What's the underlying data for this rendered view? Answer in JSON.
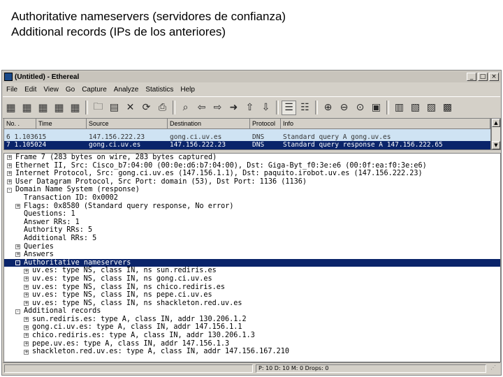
{
  "caption": {
    "line1": "Authoritative nameservers (servidores de confianza)",
    "line2": "Additional records (IPs de los anteriores)"
  },
  "window": {
    "title": "(Untitled) - Ethereal",
    "minimize": "_",
    "maximize": "□",
    "close": "×"
  },
  "menu": [
    "File",
    "Edit",
    "View",
    "Go",
    "Capture",
    "Analyze",
    "Statistics",
    "Help"
  ],
  "toolbar_icons": [
    "interfaces-icon",
    "capture-options-icon",
    "capture-start-icon",
    "capture-stop-icon",
    "capture-restart-icon",
    "open-file-icon",
    "save-file-icon",
    "close-file-icon",
    "reload-icon",
    "print-icon",
    "find-packet-icon",
    "go-back-icon",
    "go-forward-icon",
    "go-to-packet-icon",
    "go-first-icon",
    "go-last-icon",
    "colorize-icon",
    "auto-scroll-icon",
    "zoom-in-icon",
    "zoom-out-icon",
    "zoom-normal-icon",
    "resize-columns-icon",
    "capture-filters-icon",
    "display-filters-icon",
    "coloring-rules-icon",
    "preferences-icon"
  ],
  "packet_list": {
    "columns": [
      "No. .",
      "Time",
      "Source",
      "Destination",
      "Protocol",
      "Info"
    ],
    "rows": [
      {
        "no": "",
        "time": "",
        "src": "",
        "dst": "",
        "proto": "",
        "info": ""
      },
      {
        "no": "6 1.103615",
        "time": "",
        "src": "147.156.222.23",
        "dst": "gong.ci.uv.es",
        "proto": "DNS",
        "info": "Standard query A gong.uv.es"
      },
      {
        "no": "7 1.105024",
        "time": "",
        "src": "gong.ci.uv.es",
        "dst": "147.156.222.23",
        "proto": "DNS",
        "info": "Standard query response A 147.156.222.65"
      }
    ]
  },
  "details": [
    {
      "indent": 0,
      "box": "+",
      "text": "Frame 7 (283 bytes on wire, 283 bytes captured)"
    },
    {
      "indent": 0,
      "box": "+",
      "text": "Ethernet II, Src: Cisco_b7:04:00 (00:0e:d6:b7:04:00), Dst: Giga-Byt_f0:3e:e6 (00:0f:ea:f0:3e:e6)"
    },
    {
      "indent": 0,
      "box": "+",
      "text": "Internet Protocol, Src: gong.ci.uv.es (147.156.1.1), Dst: paquito.irobot.uv.es (147.156.222.23)"
    },
    {
      "indent": 0,
      "box": "+",
      "text": "User Datagram Protocol, Src Port: domain (53), Dst Port: 1136 (1136)"
    },
    {
      "indent": 0,
      "box": "-",
      "text": "Domain Name System (response)"
    },
    {
      "indent": 1,
      "box": "",
      "text": "Transaction ID: 0x0002"
    },
    {
      "indent": 1,
      "box": "+",
      "text": "Flags: 0x8580 (Standard query response, No error)"
    },
    {
      "indent": 1,
      "box": "",
      "text": "Questions: 1"
    },
    {
      "indent": 1,
      "box": "",
      "text": "Answer RRs: 1"
    },
    {
      "indent": 1,
      "box": "",
      "text": "Authority RRs: 5"
    },
    {
      "indent": 1,
      "box": "",
      "text": "Additional RRs: 5"
    },
    {
      "indent": 1,
      "box": "+",
      "text": "Queries"
    },
    {
      "indent": 1,
      "box": "+",
      "text": "Answers"
    },
    {
      "indent": 1,
      "box": "-",
      "text": "Authoritative nameservers",
      "selected": true
    },
    {
      "indent": 2,
      "box": "+",
      "text": "uv.es: type NS, class IN, ns sun.rediris.es"
    },
    {
      "indent": 2,
      "box": "+",
      "text": "uv.es: type NS, class IN, ns gong.ci.uv.es"
    },
    {
      "indent": 2,
      "box": "+",
      "text": "uv.es: type NS, class IN, ns chico.rediris.es"
    },
    {
      "indent": 2,
      "box": "+",
      "text": "uv.es: type NS, class IN, ns pepe.ci.uv.es"
    },
    {
      "indent": 2,
      "box": "+",
      "text": "uv.es: type NS, class IN, ns shackleton.red.uv.es"
    },
    {
      "indent": 1,
      "box": "-",
      "text": "Additional records"
    },
    {
      "indent": 2,
      "box": "+",
      "text": "sun.rediris.es: type A, class IN, addr 130.206.1.2"
    },
    {
      "indent": 2,
      "box": "+",
      "text": "gong.ci.uv.es: type A, class IN, addr 147.156.1.1"
    },
    {
      "indent": 2,
      "box": "+",
      "text": "chico.rediris.es: type A, class IN, addr 130.206.1.3"
    },
    {
      "indent": 2,
      "box": "+",
      "text": "pepe.uv.es: type A, class IN, addr 147.156.1.3"
    },
    {
      "indent": 2,
      "box": "+",
      "text": "shackleton.red.uv.es: type A, class IN, addr 147.156.167.210"
    }
  ],
  "status": {
    "main": "",
    "packets": "P: 10 D: 10 M: 0 Drops: 0"
  },
  "colors": {
    "selection": "#0a246a",
    "window_bg": "#d4d0c8",
    "packet_highlight": "#cfe3f3"
  }
}
